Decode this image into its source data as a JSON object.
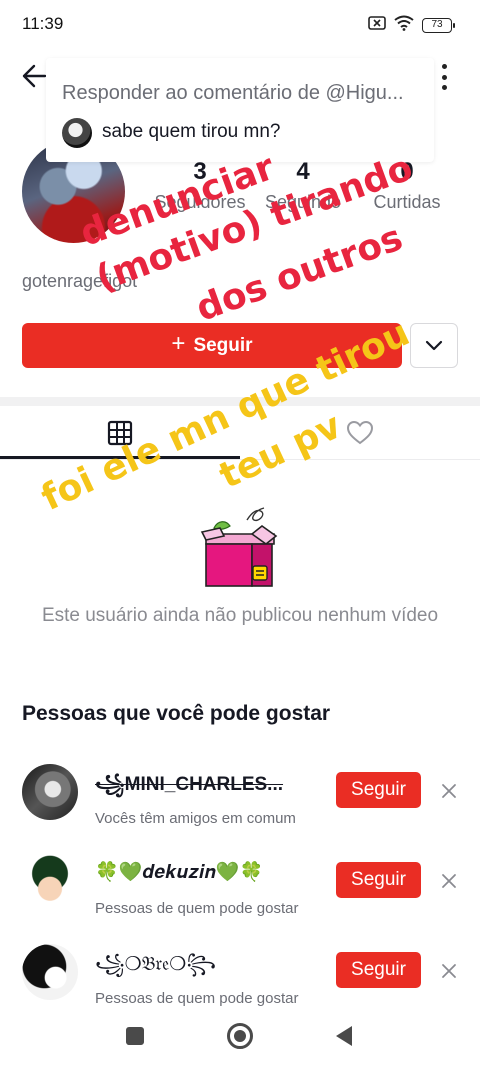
{
  "status_bar": {
    "time": "11:39",
    "battery": "73"
  },
  "reply_popup": {
    "title": "Responder ao comentário de @Higu...",
    "comment": "sabe quem tirou mn?"
  },
  "profile": {
    "stats": [
      {
        "value": "3",
        "label": "Seguidores"
      },
      {
        "value": "4",
        "label": "Seguindo"
      },
      {
        "value": "0",
        "label": "Curtidas"
      }
    ],
    "username": "gotenragefigot",
    "follow_label": "Seguir",
    "follow_plus": "+"
  },
  "empty_state": {
    "text": "Este usuário ainda não publicou nenhum vídeo"
  },
  "suggestions": {
    "title": "Pessoas que você pode gostar",
    "items": [
      {
        "name": "꧁MINI_CHARLES...",
        "subtitle": "Vocês têm amigos em comum",
        "button": "Seguir"
      },
      {
        "name": "🍀💚𝒅𝒆𝒌𝒖𝒛𝒊𝒏💚🍀",
        "subtitle": "Pessoas de quem pode gostar",
        "button": "Seguir"
      },
      {
        "name": "꧁❍𝔅𝔯𝔢❍꧂",
        "subtitle": "Pessoas de quem pode gostar",
        "button": "Seguir"
      }
    ]
  },
  "overlay_texts": {
    "red_1": "denunciar",
    "red_2": "(motivo) tirando",
    "red_3": "dos outros",
    "yellow_1": "foi ele mn que tirou",
    "yellow_2": "teu pv"
  },
  "colors": {
    "accent": "#ea2d24",
    "overlay_red": "#e8253f",
    "overlay_yellow": "#f5c518"
  }
}
